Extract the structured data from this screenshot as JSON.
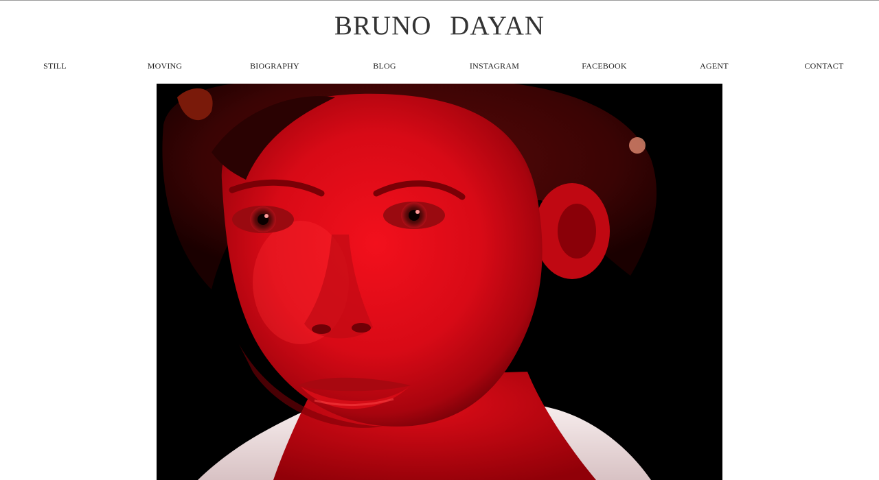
{
  "site": {
    "title": "BRUNO DAYAN"
  },
  "nav": {
    "items": [
      {
        "label": "STILL",
        "name": "nav-item-still"
      },
      {
        "label": "MOVING",
        "name": "nav-item-moving"
      },
      {
        "label": "BIOGRAPHY",
        "name": "nav-item-biography"
      },
      {
        "label": "BLOG",
        "name": "nav-item-blog"
      },
      {
        "label": "INSTAGRAM",
        "name": "nav-item-instagram"
      },
      {
        "label": "FACEBOOK",
        "name": "nav-item-facebook"
      },
      {
        "label": "AGENT",
        "name": "nav-item-agent"
      },
      {
        "label": "CONTACT",
        "name": "nav-item-contact"
      }
    ]
  },
  "hero": {
    "subject": "portrait-red-light",
    "colors": {
      "background": "#000000",
      "skin": "#e0101c",
      "skin_shadow": "#8a0008",
      "highlight": "#ff3030",
      "collar": "#f2e4e4"
    }
  }
}
